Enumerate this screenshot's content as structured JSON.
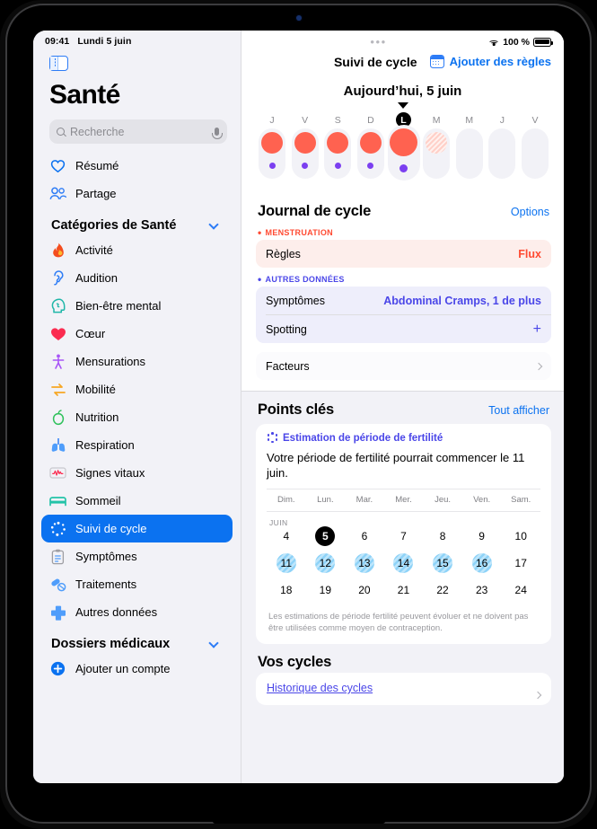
{
  "statusbar": {
    "time": "09:41",
    "date": "Lundi 5 juin",
    "dots": "•••",
    "battery_label": "100 %",
    "wifi_icon": "wifi-icon",
    "battery_icon": "battery-full-icon"
  },
  "sidebar": {
    "toggle_icon": "sidebar-toggle-icon",
    "app_title": "Santé",
    "search": {
      "placeholder": "Recherche",
      "value": "",
      "search_icon": "search-icon",
      "mic_icon": "microphone-icon"
    },
    "top_items": [
      {
        "label": "Résumé",
        "icon": "heart-outline-icon"
      },
      {
        "label": "Partage",
        "icon": "two-people-icon"
      }
    ],
    "categories_section": {
      "label": "Catégories de Santé",
      "chevron_icon": "chevron-down-icon"
    },
    "categories": [
      {
        "label": "Activité",
        "icon": "flame-icon"
      },
      {
        "label": "Audition",
        "icon": "ear-icon"
      },
      {
        "label": "Bien-être mental",
        "icon": "head-profile-icon"
      },
      {
        "label": "Cœur",
        "icon": "heart-filled-icon"
      },
      {
        "label": "Mensurations",
        "icon": "body-figure-icon"
      },
      {
        "label": "Mobilité",
        "icon": "arrows-mobility-icon"
      },
      {
        "label": "Nutrition",
        "icon": "apple-icon"
      },
      {
        "label": "Respiration",
        "icon": "lungs-icon"
      },
      {
        "label": "Signes vitaux",
        "icon": "waveform-chart-icon"
      },
      {
        "label": "Sommeil",
        "icon": "bed-icon"
      },
      {
        "label": "Suivi de cycle",
        "icon": "cycle-sparkle-icon",
        "selected": true
      },
      {
        "label": "Symptômes",
        "icon": "clipboard-icon"
      },
      {
        "label": "Traitements",
        "icon": "pills-icon"
      },
      {
        "label": "Autres données",
        "icon": "plus-cross-icon"
      }
    ],
    "records_section": {
      "label": "Dossiers médicaux",
      "chevron_icon": "chevron-down-icon"
    },
    "add_account": {
      "label": "Ajouter un compte",
      "icon": "plus-circle-icon"
    },
    "selected_accent": "#0B72F0"
  },
  "header": {
    "title": "Suivi de cycle",
    "add_period": {
      "label": "Ajouter des règles",
      "icon": "calendar-icon"
    },
    "today_label": "Aujourd’hui, 5 juin",
    "caret_icon": "caret-down-icon"
  },
  "weekstrip": {
    "days": [
      {
        "letter": "J",
        "flow": "full",
        "dot": true,
        "today": false
      },
      {
        "letter": "V",
        "flow": "full",
        "dot": true,
        "today": false
      },
      {
        "letter": "S",
        "flow": "full",
        "dot": true,
        "today": false
      },
      {
        "letter": "D",
        "flow": "full",
        "dot": true,
        "today": false
      },
      {
        "letter": "L",
        "flow": "full",
        "dot": true,
        "today": true
      },
      {
        "letter": "M",
        "flow": "predicted",
        "dot": false,
        "today": false
      },
      {
        "letter": "M",
        "flow": "none",
        "dot": false,
        "today": false
      },
      {
        "letter": "J",
        "flow": "none",
        "dot": false,
        "today": false
      },
      {
        "letter": "V",
        "flow": "none",
        "dot": false,
        "today": false
      }
    ],
    "flow_color": "#FF6250",
    "dot_color": "#7B3FF0"
  },
  "journal": {
    "title": "Journal de cycle",
    "options_label": "Options",
    "menstruation_group": {
      "label": "MENSTRUATION",
      "color": "#FF4A32"
    },
    "menstruation_rows": [
      {
        "label": "Règles",
        "value": "Flux"
      }
    ],
    "other_group": {
      "label": "AUTRES DONNÉES",
      "color": "#4A46E8"
    },
    "other_rows": [
      {
        "label": "Symptômes",
        "value": "Abdominal Cramps, 1 de plus"
      },
      {
        "label": "Spotting",
        "value": "+"
      }
    ],
    "factors_row": {
      "label": "Facteurs",
      "chevron_icon": "chevron-right-icon"
    }
  },
  "points_cles": {
    "title": "Points clés",
    "show_all_label": "Tout afficher",
    "card": {
      "badge": {
        "label": "Estimation de période de fertilité",
        "icon": "sparkle-ring-icon"
      },
      "text": "Votre période de fertilité pourrait commencer le 11 juin.",
      "weekday_headers": [
        "Dim.",
        "Lun.",
        "Mar.",
        "Mer.",
        "Jeu.",
        "Ven.",
        "Sam."
      ],
      "month_label": "JUIN",
      "weeks": [
        [
          {
            "day": "4"
          },
          {
            "day": "5",
            "state": "today"
          },
          {
            "day": "6"
          },
          {
            "day": "7"
          },
          {
            "day": "8"
          },
          {
            "day": "9"
          },
          {
            "day": "10"
          }
        ],
        [
          {
            "day": "11",
            "state": "fertile"
          },
          {
            "day": "12",
            "state": "fertile"
          },
          {
            "day": "13",
            "state": "fertile"
          },
          {
            "day": "14",
            "state": "fertile"
          },
          {
            "day": "15",
            "state": "fertile"
          },
          {
            "day": "16",
            "state": "fertile"
          },
          {
            "day": "17"
          }
        ],
        [
          {
            "day": "18"
          },
          {
            "day": "19"
          },
          {
            "day": "20"
          },
          {
            "day": "21"
          },
          {
            "day": "22"
          },
          {
            "day": "23"
          },
          {
            "day": "24"
          }
        ]
      ],
      "note": "Les estimations de période fertilité peuvent évoluer et ne doivent pas être utilisées comme moyen de contraception.",
      "fertile_color": "#8FD3F8",
      "today_color": "#000000"
    }
  },
  "vos_cycles": {
    "title": "Vos cycles",
    "link_label": "Historique des cycles",
    "chevron_icon": "chevron-right-icon"
  },
  "home_indicator": "home-indicator"
}
